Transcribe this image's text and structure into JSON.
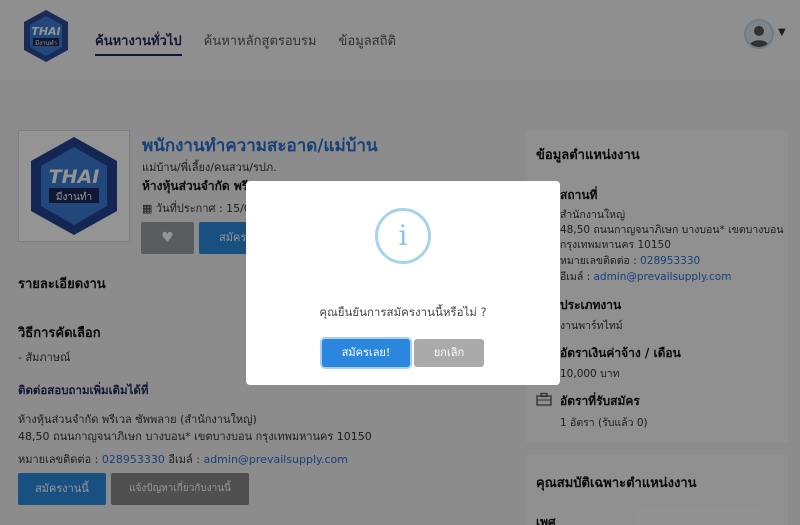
{
  "nav": {
    "items": [
      "ค้นหางานทั่วไป",
      "ค้นหาหลักสูตรอบรม",
      "ข้อมูลสถิติ"
    ]
  },
  "logo": {
    "text_main": "THAI",
    "text_sub": "มีงานทำ",
    "ring_text": "BETTER SKILLS BETTER JOBS"
  },
  "job": {
    "title": "พนักงานทำความสะอาด/แม่บ้าน",
    "category": "แม่บ้าน/พี่เลี้ยง/คนสวน/รปภ.",
    "company": "ห้างหุ้นส่วนจำกัด พรีเวล",
    "post_date": "วันที่ประกาศ : 15/09",
    "favorite_icon": "heart-icon",
    "apply_label": "สมัคร"
  },
  "main": {
    "details_heading": "รายละเอียดงาน",
    "selection_heading": "วิธีการคัดเลือก",
    "selection_item": "- สัมภาษณ์",
    "contact_heading": "ติดต่อสอบถามเพิ่มเติมได้ที่",
    "contact_company": "ห้างหุ้นส่วนจำกัด พรีเวล ซัพพลาย (สำนักงานใหญ่)",
    "contact_address": "48,50 ถนนกาญจนาภิเษก บางบอน* เขตบางบอน กรุงเทพมหานคร 10150",
    "phone_label": "หมายเลขติดต่อ :",
    "phone": "028953330",
    "email_label": "อีเมล์ :",
    "email": "admin@prevailsupply.com",
    "apply_button": "สมัครงานนี้",
    "report_button": "แจ้งปัญหาเกี่ยวกับงานนี้"
  },
  "side": {
    "heading": "ข้อมูลตำแหน่งงาน",
    "location_heading": "สถานที่",
    "location_lines": [
      "สำนักงานใหญ่",
      "48,50 ถนนกาญจนาภิเษก บางบอน* เขตบางบอน",
      "กรุงเทพมหานคร 10150"
    ],
    "phone_label": "หมายเลขติดต่อ :",
    "phone": "028953330",
    "email_label": "อีเมล์ :",
    "email": "admin@prevailsupply.com",
    "type_heading": "ประเภทงาน",
    "type_value": "งานพาร์ทไทม์",
    "wage_heading": "อัตราเงินค่าจ้าง / เดือน",
    "wage_value": "10,000 บาท",
    "openings_heading": "อัตราที่รับสมัคร",
    "openings_value": "1 อัตรา (รับแล้ว 0)",
    "qualifications_heading": "คุณสมบัติเฉพาะตำแหน่งงาน",
    "sex_label": "เพศ"
  },
  "modal": {
    "icon": "info-icon",
    "message": "คุณยืนยันการสมัครงานนี้หรือไม่ ?",
    "confirm_label": "สมัครเลย!",
    "cancel_label": "ยกเลิก"
  },
  "colors": {
    "primary": "#2a8be0",
    "title_blue": "#2a6fd0",
    "overlay": "rgba(0,0,0,0.42)"
  }
}
